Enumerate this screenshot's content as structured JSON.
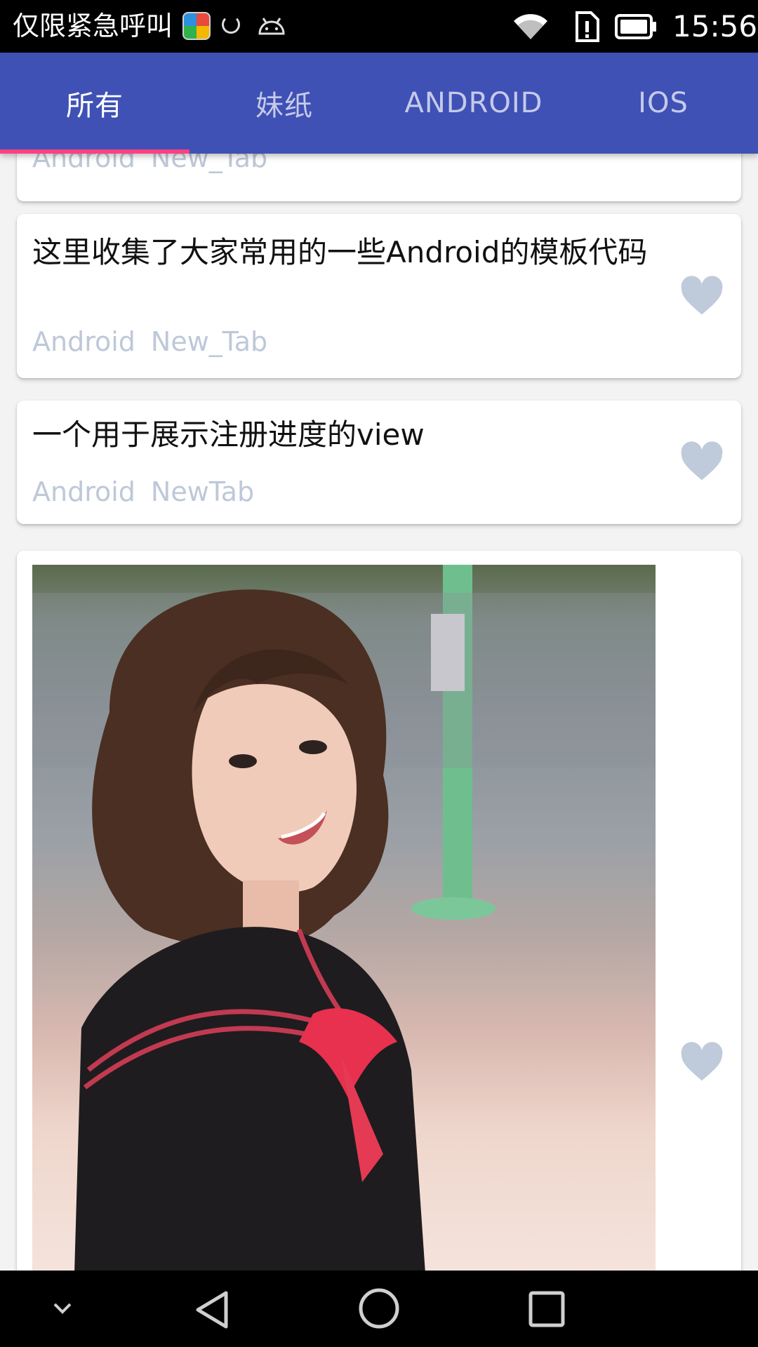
{
  "status_bar": {
    "carrier": "仅限紧急呼叫",
    "time": "15:56",
    "icons": [
      "app-icon",
      "sync-icon",
      "android-debug-icon",
      "wifi-icon",
      "sim-icon",
      "battery-icon"
    ]
  },
  "tabs": [
    {
      "label": "所有",
      "active": true
    },
    {
      "label": "妹纸",
      "active": false
    },
    {
      "label": "ANDROID",
      "active": false
    },
    {
      "label": "IOS",
      "active": false
    }
  ],
  "cards": [
    {
      "title": "",
      "tags": [
        "Android",
        "New_Tab"
      ]
    },
    {
      "title": "这里收集了大家常用的一些Android的模板代码",
      "tags": [
        "Android",
        "New_Tab"
      ]
    },
    {
      "title": "一个用于展示注册进度的view",
      "tags": [
        "Android",
        "NewTab"
      ]
    },
    {
      "title": "",
      "tags": [],
      "image": "girl-photo"
    }
  ],
  "colors": {
    "app_bar": "#3f51b5",
    "tab_indicator": "#ff4081",
    "heart": "#bfcadb",
    "tag_text": "#bec8d8"
  },
  "nav_bar": {
    "icons": [
      "chevron-down-icon",
      "back-icon",
      "home-icon",
      "recents-icon"
    ]
  }
}
